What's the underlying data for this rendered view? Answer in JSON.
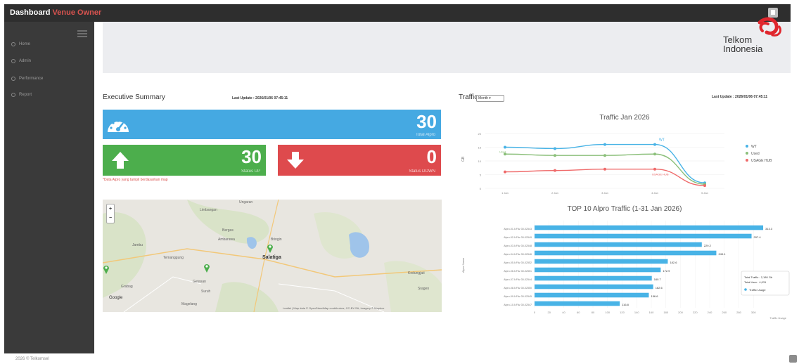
{
  "header": {
    "title_part1": "Dashboard",
    "title_part2": "Venue Owner"
  },
  "sidebar": {
    "items": [
      {
        "label": "Home"
      },
      {
        "label": "Admin"
      },
      {
        "label": "Performance"
      },
      {
        "label": "Report"
      }
    ]
  },
  "footer": {
    "text": "2026 © Telkomsel"
  },
  "logo": {
    "line1": "Telkom",
    "line2": "Indonesia",
    "icon": "telkom-logo"
  },
  "executive": {
    "title": "Executive Summary",
    "last_update": "Last Update : 2026/01/06 07:45:11",
    "total": {
      "value": "30",
      "label": "Total Alpro",
      "icon": "speedometer-icon"
    },
    "up": {
      "value": "30",
      "label": "Status UP",
      "icon": "arrow-up-icon"
    },
    "down": {
      "value": "0",
      "label": "Status DOWN",
      "icon": "arrow-down-icon"
    },
    "note": "*Data Alpro yang tampil berdasarkan map"
  },
  "map": {
    "zoom_in": "+",
    "zoom_out": "−",
    "city": "Salatiga",
    "labels": [
      "Ungaran",
      "Limbangan",
      "Bergas",
      "Ambarawa",
      "Jambu",
      "Bringin",
      "Temanggung",
      "Getasan",
      "Grabag",
      "Suruh",
      "Kedungjati",
      "Sragen",
      "Magelang"
    ],
    "google": "Google",
    "attribution": "Leaflet | Map data © OpenStreetMap contributors, CC-BY-SA, Imagery © Mapbox"
  },
  "traffic": {
    "title": "Traffic",
    "select_value": "Month",
    "last_update": "Last Update : 2026/01/06 07:45:11",
    "colors": {
      "wt": "#48b3e6",
      "used": "#8bbf7a",
      "usage_hub": "#ef6a6a"
    }
  },
  "chart_data": [
    {
      "type": "line",
      "title": "Traffic Jan 2026",
      "ylabel": "GB",
      "x": [
        "1 Jan",
        "2 Jan",
        "3 Jan",
        "4 Jan",
        "5 Jan"
      ],
      "ylim": [
        0,
        20
      ],
      "yticks": [
        "0",
        "5",
        "10",
        "15",
        "20"
      ],
      "series": [
        {
          "name": "WT",
          "values": [
            15,
            14.5,
            16,
            16,
            2
          ]
        },
        {
          "name": "Used",
          "values": [
            12.5,
            12,
            12,
            12.5,
            1.5
          ]
        },
        {
          "name": "USAGE HUB",
          "values": [
            6,
            6.5,
            7,
            7,
            1
          ]
        }
      ],
      "annotations": [
        "WT",
        "Used",
        "USAGE HUB"
      ],
      "legend": "right"
    },
    {
      "type": "bar",
      "title": "TOP 10 Alpro Traffic (1-31 Jan 2026)",
      "ylabel": "Alpro Name",
      "xlabel": "Traffic Usage",
      "categories": [
        "Alpro-01 A Fdz 30-02543",
        "Alpro-02 A Fdz 30-02549",
        "Alpro-03 A Fdz 30-02548",
        "Alpro-04 A Fdz 30-02546",
        "Alpro-05 A Fdz 30-02552",
        "Alpro-06 A Fdz 30-02551",
        "Alpro-07 A Fdz 30-02544",
        "Alpro-08 A Fdz 30-02550",
        "Alpro-09 A Fdz 30-02545",
        "Alpro-10 A Fdz 30-02547"
      ],
      "values": [
        313.3,
        297.4,
        229.2,
        249.1,
        182.6,
        172.9,
        160.7,
        162.6,
        156.6,
        116.8
      ],
      "value_labels": [
        "313.3",
        "297.4",
        "229.2",
        "249.1",
        "182.6",
        "172.9",
        "160.7",
        "162.6",
        "156.6",
        "116.8"
      ],
      "xlim": [
        0,
        320
      ],
      "xticks": [
        "0",
        "20",
        "40",
        "60",
        "80",
        "100",
        "120",
        "140",
        "160",
        "180",
        "200",
        "220",
        "240",
        "260",
        "280",
        "300"
      ],
      "series": [
        {
          "name": "Traffic Usage",
          "values": [
            313.3,
            297.4,
            229.2,
            249.1,
            182.6,
            172.9,
            160.7,
            162.6,
            156.6,
            116.8
          ]
        }
      ],
      "tooltip": {
        "line1": "Total Traffic : 2,180 Gb",
        "line2": "Total User : 4,031",
        "series": "Traffic Usage"
      }
    }
  ]
}
